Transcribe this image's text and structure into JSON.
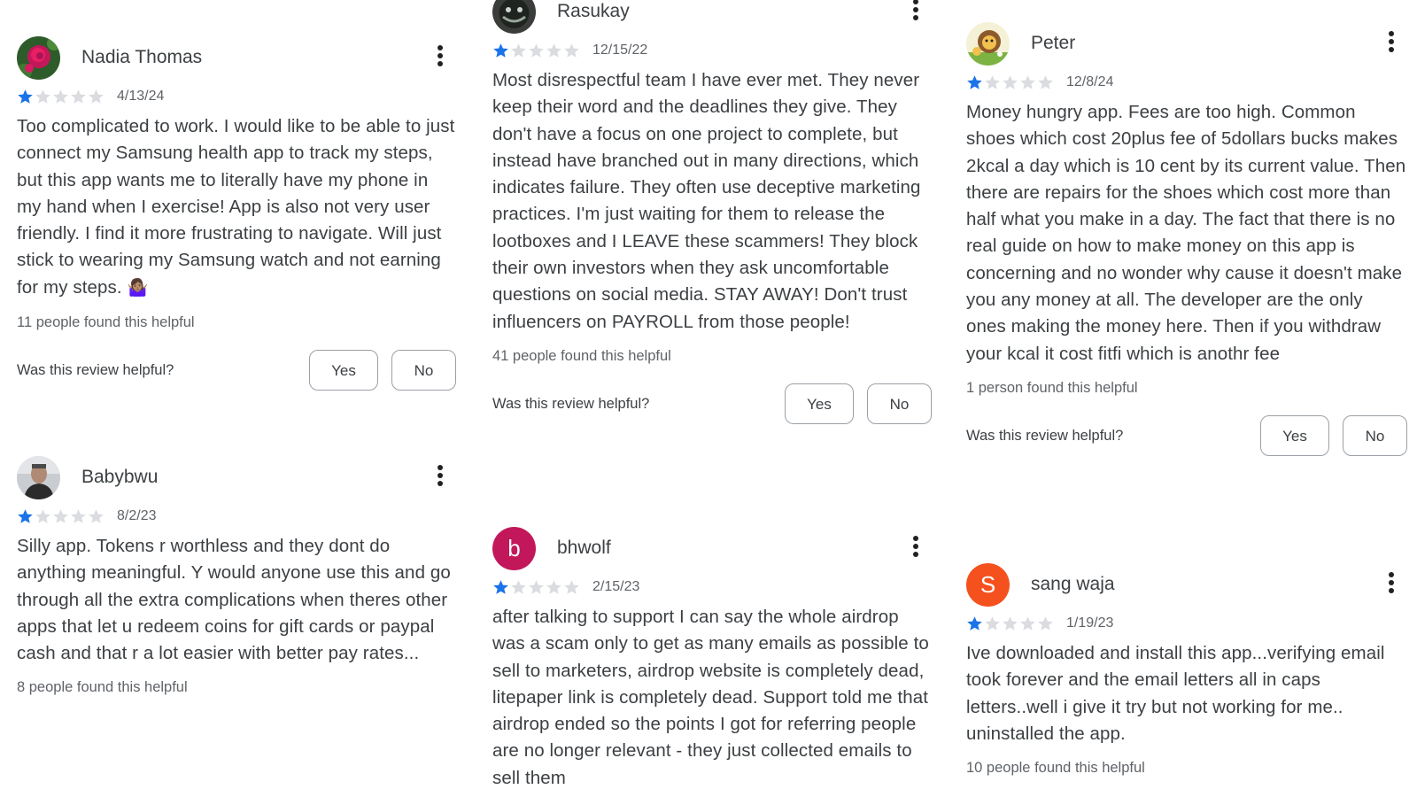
{
  "helpful_prompt": "Was this review helpful?",
  "yes_label": "Yes",
  "no_label": "No",
  "star_colors": {
    "filled": "#1a73e8",
    "empty": "#dadce0"
  },
  "columns": [
    {
      "reviews": [
        {
          "reviewer": "Nadia Thomas",
          "avatar": "rose-photo",
          "rating": 1,
          "max_rating": 5,
          "date": "4/13/24",
          "text": "Too complicated to work. I would like to be able to just connect my Samsung health app to track my steps, but this app wants me to literally have my phone in my hand when I exercise! App is also not very user friendly. I find it more frustrating to navigate. Will just stick to wearing my Samsung watch and not earning for my steps.",
          "emoji": "🤷🏽‍♀️",
          "helpful_count": "11 people found this helpful"
        },
        {
          "reviewer": "Babybwu",
          "avatar": "person-photo",
          "rating": 1,
          "max_rating": 5,
          "date": "8/2/23",
          "text": "Silly app. Tokens r worthless and they dont do anything meaningful. Y would anyone use this and go through all the extra complications when theres other apps that let u redeem coins for gift cards or paypal cash and that r a lot easier with better pay rates...",
          "helpful_count": "8 people found this helpful"
        }
      ]
    },
    {
      "reviews": [
        {
          "reviewer": "Rasukay",
          "avatar": "mask-photo",
          "rating": 1,
          "max_rating": 5,
          "date": "12/15/22",
          "text": "Most disrespectful team I have ever met. They never keep their word and the deadlines they give. They don't have a focus on one project to complete, but instead have branched out in many directions, which indicates failure. They often use deceptive marketing practices. I'm just waiting for them to release the lootboxes and I LEAVE these scammers! They block their own investors when they ask uncomfortable questions on social media. STAY AWAY! Don't trust influencers on PAYROLL from those people!",
          "helpful_count": "41 people found this helpful"
        },
        {
          "reviewer": "bhwolf",
          "avatar_letter": "b",
          "avatar_color": "#c2185b",
          "rating": 1,
          "max_rating": 5,
          "date": "2/15/23",
          "text": "after talking to support I can say the whole airdrop was a scam only to get as many emails as possible to sell to marketers, airdrop website is completely dead, litepaper link is completely dead. Support told me that airdrop ended so the points I got for referring people are no longer relevant - they just collected emails to sell them"
        }
      ]
    },
    {
      "reviews": [
        {
          "reviewer": "Peter",
          "avatar": "lion-cartoon",
          "rating": 1,
          "max_rating": 5,
          "date": "12/8/24",
          "text": "Money hungry app. Fees are too high. Common shoes which cost 20plus fee of 5dollars bucks makes 2kcal a day which is 10 cent by its current value. Then there are repairs for the shoes which cost more than half what you make in a day. The fact that there is no real guide on how to make money on this app is concerning and no wonder why cause it doesn't make you any money at all. The developer are the only ones making the money here. Then if you withdraw your kcal it cost fitfi which is anothr fee",
          "helpful_count": "1 person found this helpful"
        },
        {
          "reviewer": "sang waja",
          "avatar_letter": "S",
          "avatar_color": "#f4511e",
          "rating": 1,
          "max_rating": 5,
          "date": "1/19/23",
          "text": "Ive downloaded and install this app...verifying email took forever and the email letters all in caps letters..well i give it try but not working for me.. uninstalled the app.",
          "helpful_count": "10 people found this helpful"
        }
      ]
    }
  ]
}
